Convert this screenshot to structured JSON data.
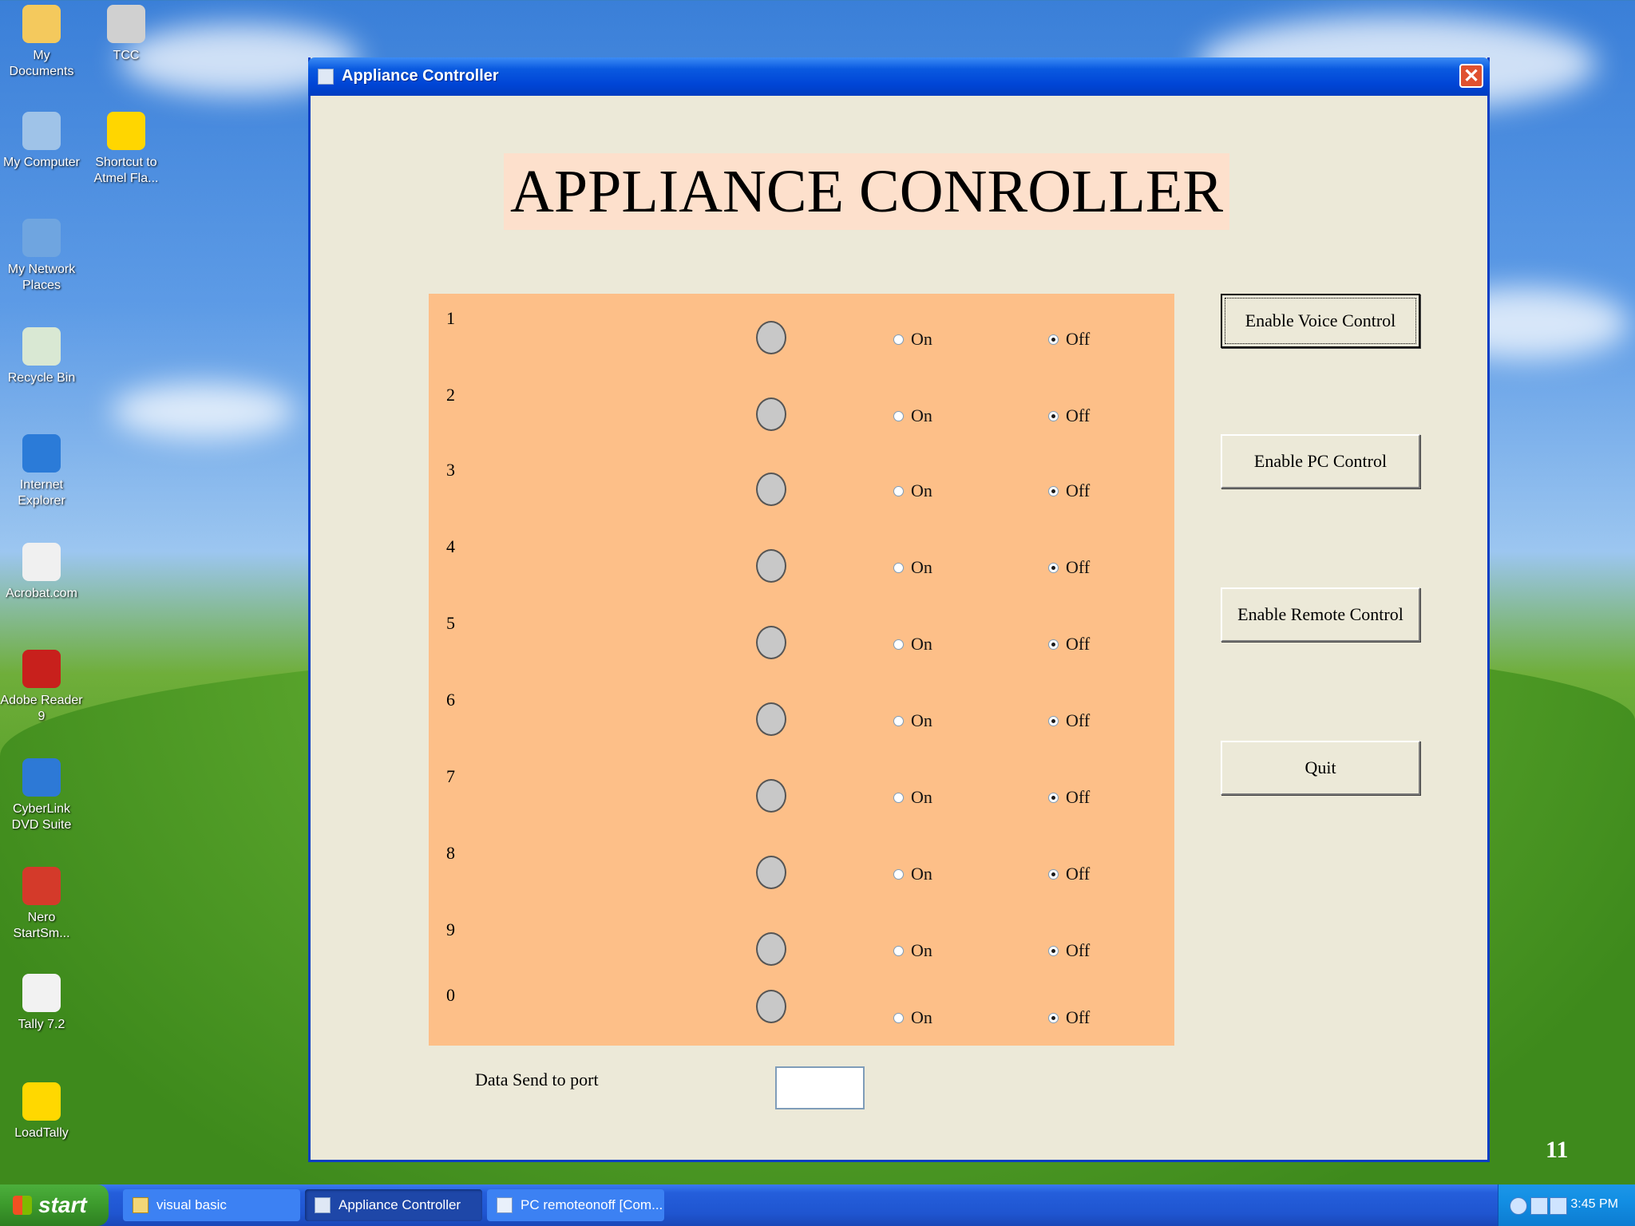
{
  "desktop": {
    "icons": [
      {
        "label": "My Documents",
        "icon": "folder-documents-icon",
        "color": "#f4c95d"
      },
      {
        "label": "TCC",
        "icon": "msdos-shortcut-icon",
        "color": "#d0d0d0"
      },
      {
        "label": "My Computer",
        "icon": "computer-icon",
        "color": "#9fc3e8"
      },
      {
        "label": "Shortcut to Atmel Fla...",
        "icon": "atmel-fe-icon",
        "color": "#ffd600"
      },
      {
        "label": "My Network Places",
        "icon": "network-places-icon",
        "color": "#6fa5e0"
      },
      {
        "label": "Recycle Bin",
        "icon": "recycle-bin-icon",
        "color": "#d9e8d3"
      },
      {
        "label": "Internet Explorer",
        "icon": "internet-explorer-icon",
        "color": "#2b7bd8"
      },
      {
        "label": "Acrobat.com",
        "icon": "acrobat-icon",
        "color": "#f0f0f0"
      },
      {
        "label": "Adobe Reader 9",
        "icon": "adobe-reader-icon",
        "color": "#c8201c"
      },
      {
        "label": "CyberLink DVD Suite",
        "icon": "cyberlink-icon",
        "color": "#2d79d6"
      },
      {
        "label": "Nero StartSm...",
        "icon": "nero-icon",
        "color": "#d43a2a"
      },
      {
        "label": "Tally 7.2",
        "icon": "tally-icon",
        "color": "#f2f2f2"
      },
      {
        "label": "LoadTally",
        "icon": "radiation-icon",
        "color": "#ffd800"
      }
    ],
    "slide_number": "11"
  },
  "window": {
    "title": "Appliance Controller",
    "close": "✕",
    "heading": "APPLIANCE CONROLLER",
    "rows": [
      {
        "num": "1",
        "on": "On",
        "off": "Off"
      },
      {
        "num": "2",
        "on": "On",
        "off": "Off"
      },
      {
        "num": "3",
        "on": "On",
        "off": "Off"
      },
      {
        "num": "4",
        "on": "On",
        "off": "Off"
      },
      {
        "num": "5",
        "on": "On",
        "off": "Off"
      },
      {
        "num": "6",
        "on": "On",
        "off": "Off"
      },
      {
        "num": "7",
        "on": "On",
        "off": "Off"
      },
      {
        "num": "8",
        "on": "On",
        "off": "Off"
      },
      {
        "num": "9",
        "on": "On",
        "off": "Off"
      },
      {
        "num": "0",
        "on": "On",
        "off": "Off"
      }
    ],
    "selected": "Off",
    "buttons": {
      "voice": "Enable Voice Control",
      "pc": "Enable PC Control",
      "remote": "Enable Remote Control",
      "quit": "Quit"
    },
    "send_label": "Data Send to port",
    "send_value": ""
  },
  "taskbar": {
    "start": "start",
    "tasks": [
      "visual basic",
      "Appliance Controller",
      "PC remoteonoff [Com..."
    ],
    "time": "3:45 PM"
  },
  "colors": {
    "panel": "#fdbf88",
    "heading_bg": "#fde0cc",
    "window_bg": "#ece9d8",
    "titlebar": "#0a5ae0"
  }
}
